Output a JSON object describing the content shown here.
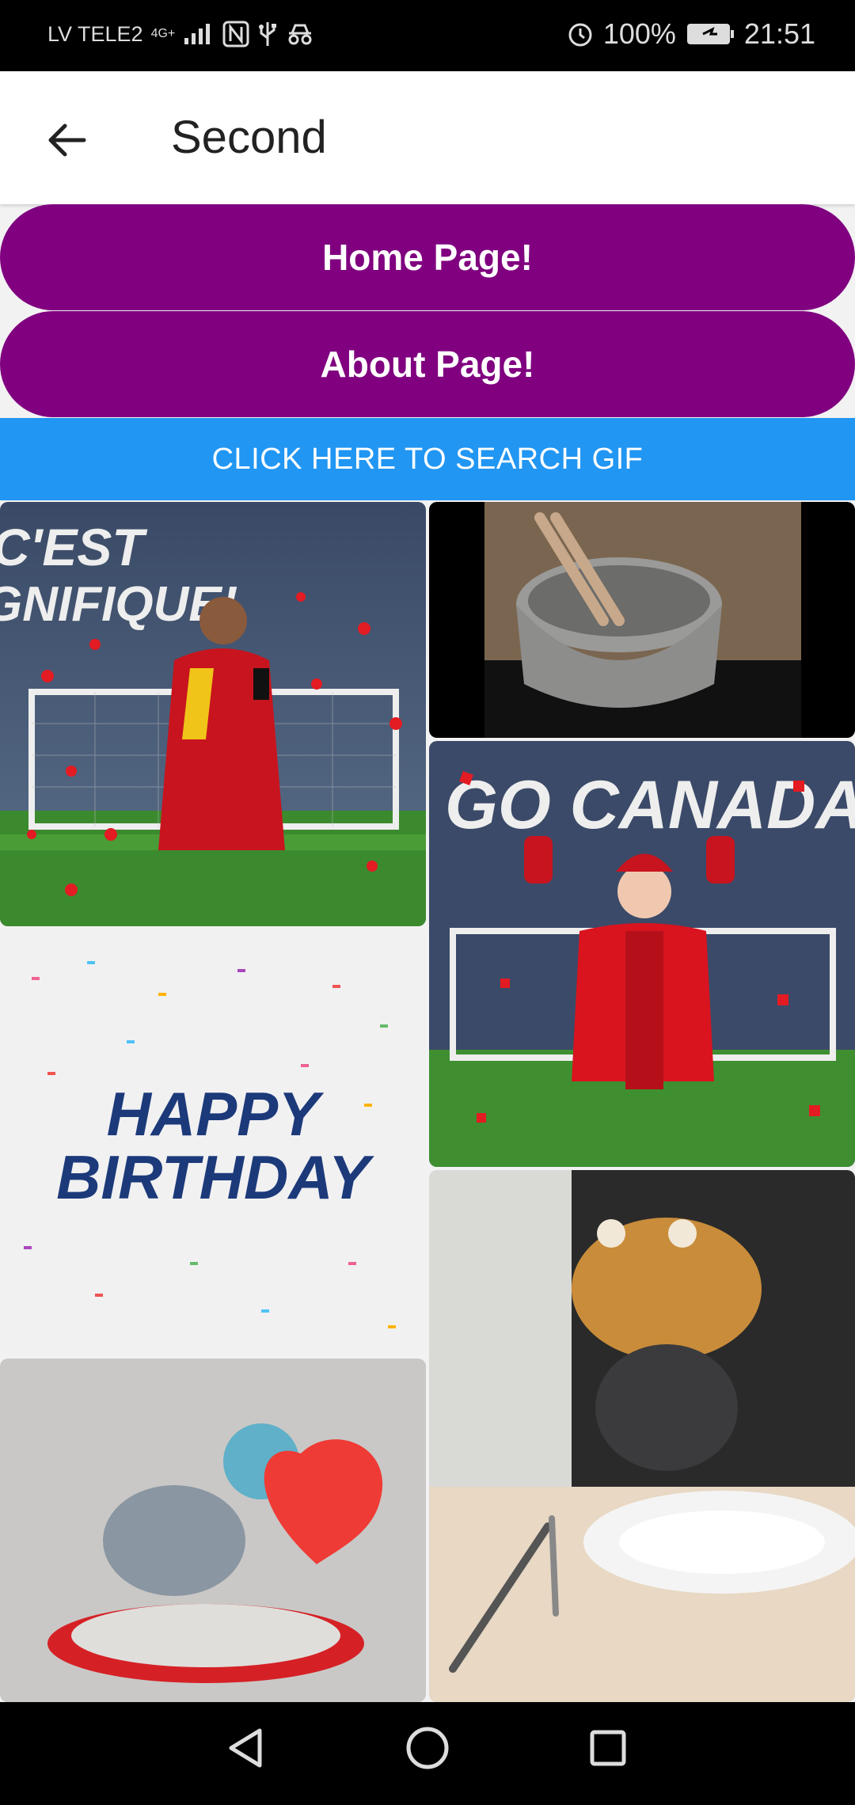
{
  "status_bar": {
    "carrier": "LV TELE2",
    "network": "4G+",
    "battery": "100%",
    "time": "21:51",
    "icons": [
      "signal-icon",
      "nfc-icon",
      "usb-icon",
      "incognito-icon",
      "alarm-icon",
      "battery-charging-icon"
    ]
  },
  "app_bar": {
    "title": "Second",
    "back_icon": "arrow-back-icon"
  },
  "buttons": {
    "home": "Home Page!",
    "about": "About Page!",
    "search": "CLICK HERE TO SEARCH GIF"
  },
  "colors": {
    "primary_purple": "#800080",
    "search_blue": "#2196f3",
    "status_black": "#000000"
  },
  "gifs": {
    "belgium_text": "C'EST\nGNIFIQUE!",
    "canada_text": "GO CANADA!",
    "birthday_line1": "HAPPY",
    "birthday_line2": "BIRTHDAY"
  },
  "nav_bar": {
    "back": "back-triangle-icon",
    "home": "home-circle-icon",
    "recents": "recents-square-icon"
  }
}
